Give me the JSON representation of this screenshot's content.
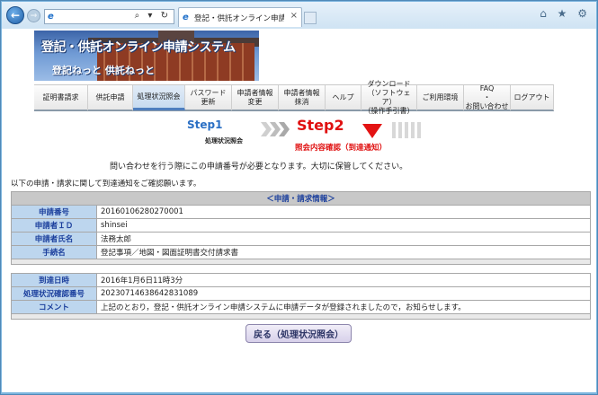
{
  "browser": {
    "tab_title": "登記・供託オンライン申請シス...",
    "back_symbol": "←",
    "forward_symbol": "→",
    "address_tools": "⌕ ▾ ↻",
    "tab_close": "×",
    "window_tools": "⌂ ★ ⚙"
  },
  "banner": {
    "title": "登記・供託オンライン申請システム",
    "subtitle": "登記ねっと 供託ねっと"
  },
  "menu": {
    "items": [
      {
        "label": "証明書請求",
        "w": 60
      },
      {
        "label": "供託申請",
        "w": 50
      },
      {
        "label": "処理状況照会",
        "w": 58,
        "active": true
      },
      {
        "label": "パスワード\n更新",
        "w": 52
      },
      {
        "label": "申請者情報\n変更",
        "w": 52
      },
      {
        "label": "申請者情報\n抹消",
        "w": 52
      },
      {
        "label": "ヘルプ",
        "w": 40
      },
      {
        "label": "ダウンロード\n（ソフトウェア）\n（操作手引書）",
        "w": 62
      },
      {
        "label": "ご利用環境",
        "w": 52
      },
      {
        "label": "FAQ\n・\nお問い合わせ",
        "w": 52
      },
      {
        "label": "ログアウト",
        "w": 48
      }
    ]
  },
  "steps": {
    "step1_label": "Step1",
    "step1_sub": "処理状況照会",
    "step2_label": "Step2",
    "step2_sub": "照会内容確認（到達通知）"
  },
  "notice": "問い合わせを行う際にこの申請番号が必要となります。大切に保管してください。",
  "intro": "以下の申請・請求に関して到達通知をご確認願います。",
  "table1": {
    "caption": "＜申請・請求情報＞",
    "rows": [
      {
        "label": "申請番号",
        "value": "20160106280270001"
      },
      {
        "label": "申請者ＩＤ",
        "value": "shinsei"
      },
      {
        "label": "申請者氏名",
        "value": "法務太郎"
      },
      {
        "label": "手続名",
        "value": "登記事項／地図・図面証明書交付請求書"
      }
    ]
  },
  "table2": {
    "rows": [
      {
        "label": "到達日時",
        "value": "2016年1月6日11時3分"
      },
      {
        "label": "処理状況確認番号",
        "value": "20230714638642831089"
      },
      {
        "label": "コメント",
        "value": "上記のとおり，登記・供託オンライン申請システムに申請データが登録されましたので，お知らせします。"
      }
    ]
  },
  "back_button_label": "戻る（処理状況照会）",
  "colors": {
    "accent_blue": "#2a6fc4",
    "step_red": "#e01010",
    "label_cell": "#bdd6ee"
  }
}
